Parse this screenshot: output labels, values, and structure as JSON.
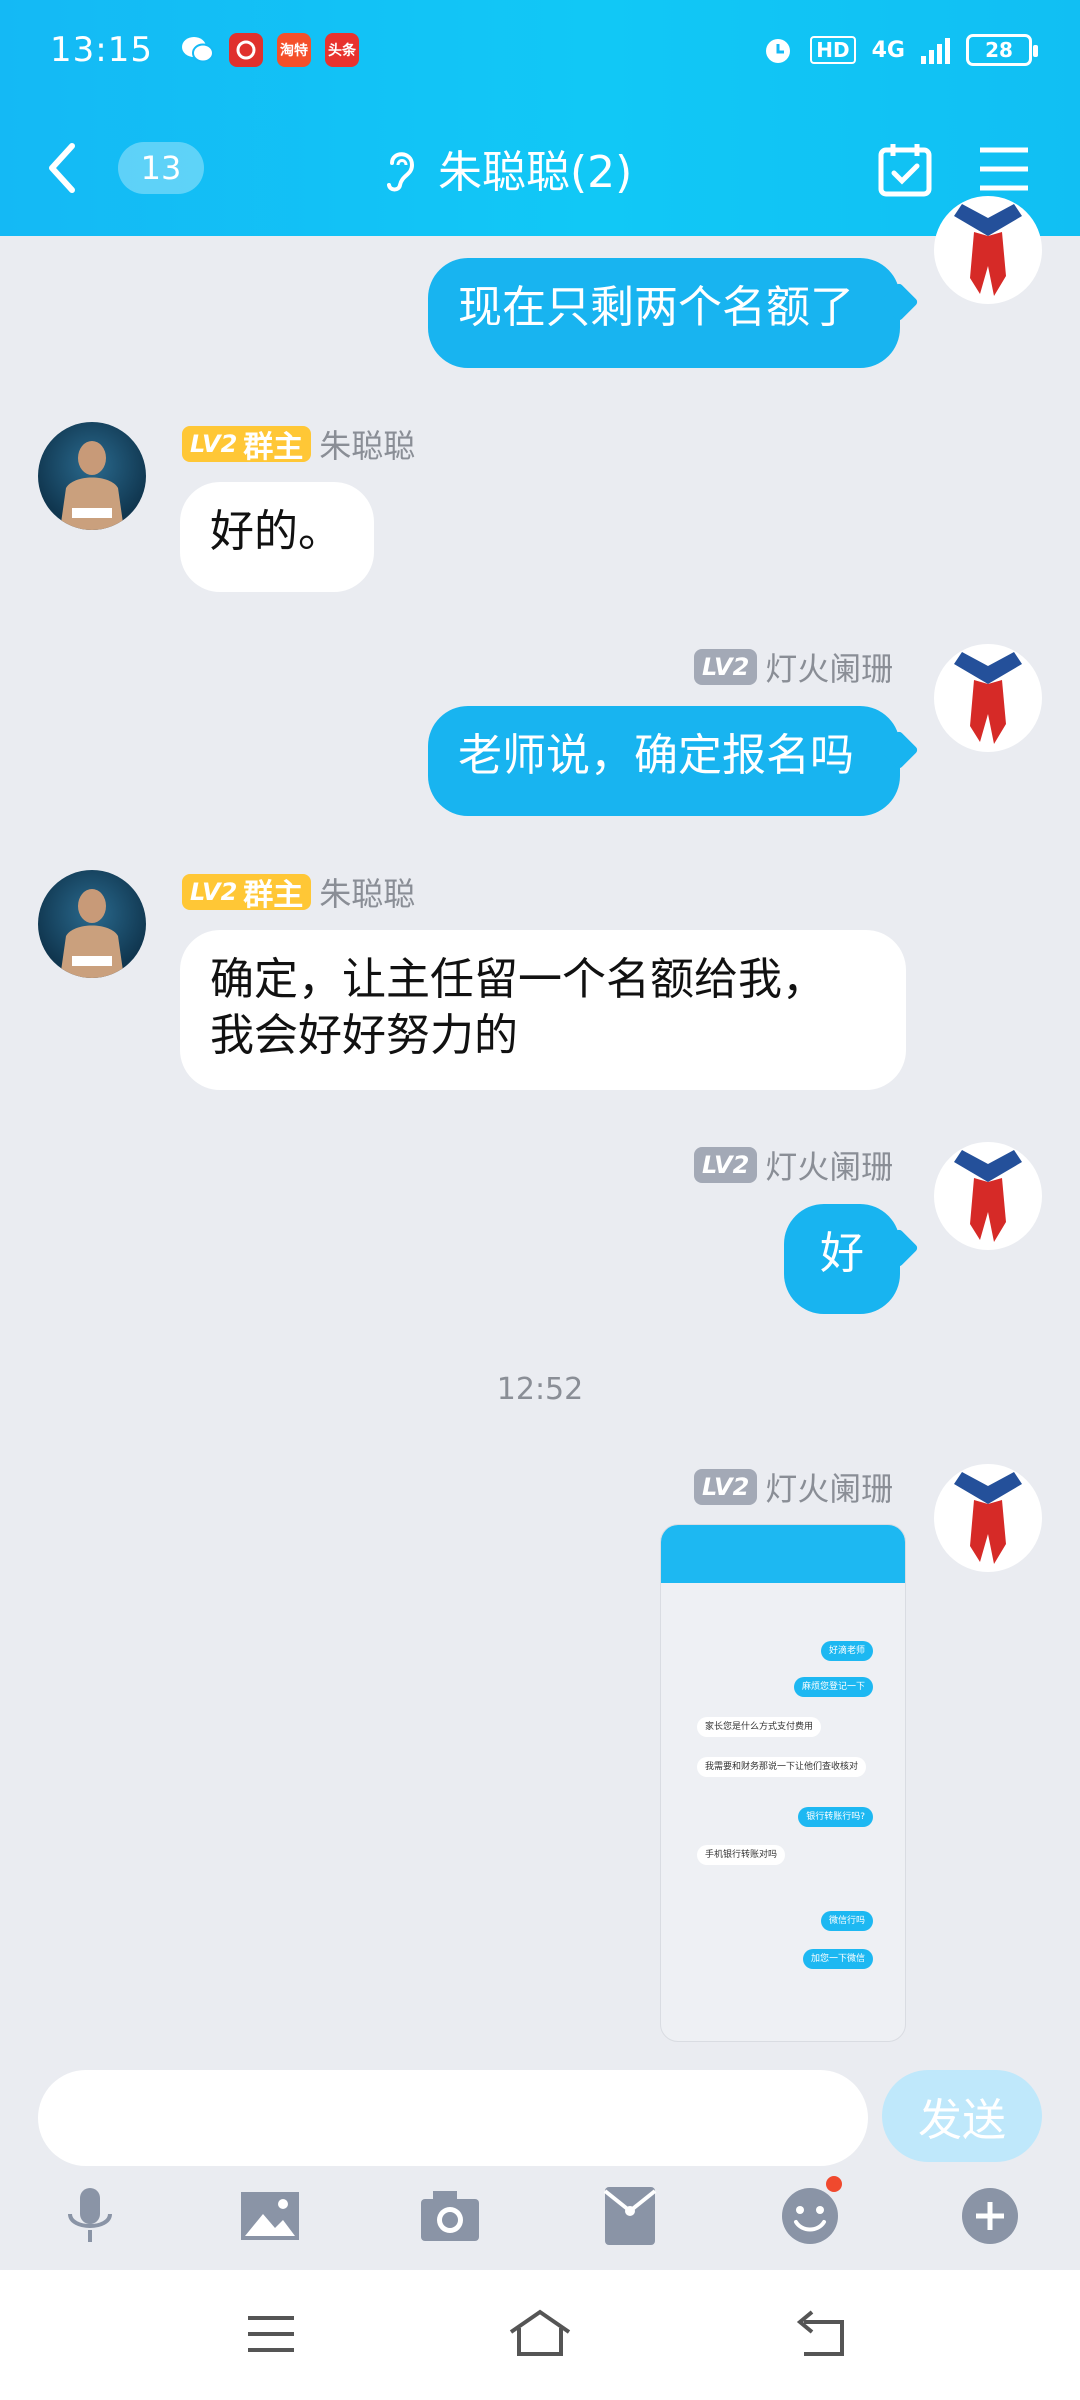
{
  "status": {
    "time": "13:15",
    "network": "4G",
    "battery": "28",
    "hd": "HD",
    "apps": [
      "wechat-icon",
      "pinduoduo-icon",
      "taobao-icon",
      "toutiao-icon"
    ],
    "app_labels": {
      "taobao": "淘特",
      "toutiao": "头条"
    }
  },
  "header": {
    "unread_count": "13",
    "title": "朱聪聪(2)"
  },
  "messages": [
    {
      "id": 0,
      "side": "out",
      "text": "现在只剩两个名额了"
    },
    {
      "id": 1,
      "side": "in",
      "level": "LV2",
      "role": "群主",
      "sender": "朱聪聪",
      "text": "好的。"
    },
    {
      "id": 2,
      "side": "out",
      "level": "LV2",
      "sender": "灯火阑珊",
      "text": "老师说，确定报名吗"
    },
    {
      "id": 3,
      "side": "in",
      "level": "LV2",
      "role": "群主",
      "sender": "朱聪聪",
      "text_line1": "确定，让主任留一个名额给我，",
      "text_line2": "我会好好努力的"
    },
    {
      "id": 4,
      "side": "out",
      "level": "LV2",
      "sender": "灯火阑珊",
      "text": "好"
    },
    {
      "id": 5,
      "side": "out",
      "level": "LV2",
      "sender": "灯火阑珊",
      "type": "image"
    }
  ],
  "timestamp": "12:52",
  "screenshot_thumb": {
    "messages": [
      "好滴老师",
      "麻烦您登记一下",
      "家长您是什么方式支付费用",
      "我需要和财务那说一下让他们查收核对",
      "银行转账行吗?",
      "手机银行转账对吗",
      "微信行吗",
      "加您一下微信"
    ]
  },
  "input": {
    "placeholder": "",
    "send_label": "发送"
  },
  "toolbar": [
    "microphone-icon",
    "image-icon",
    "camera-icon",
    "red-packet-icon",
    "emoji-icon",
    "plus-icon"
  ],
  "colors": {
    "header": "#14b9f5",
    "bubble_out": "#18b4f0",
    "bubble_in": "#ffffff",
    "chat_bg": "#eaecf1",
    "lv_gold": "#ffc736",
    "lv_grey": "#a3a9b6"
  }
}
